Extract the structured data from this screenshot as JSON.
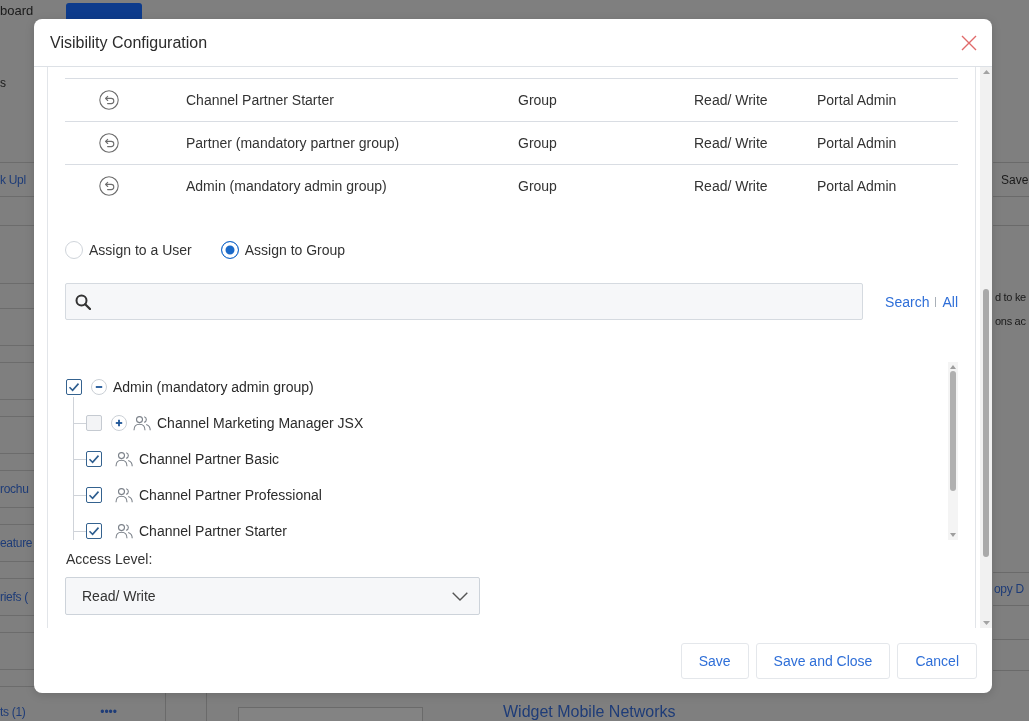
{
  "page_behind": {
    "nav_fragment": "board",
    "left_label": "s",
    "left_cards": [
      {
        "kind": "link",
        "text": "k Upl"
      },
      {
        "kind": "blank"
      },
      {
        "kind": "blank"
      },
      {
        "kind": "blank"
      },
      {
        "kind": "blank"
      },
      {
        "kind": "link",
        "text": "rochu"
      },
      {
        "kind": "link",
        "text": "eature"
      },
      {
        "kind": "link",
        "text": "riefs ("
      },
      {
        "kind": "blank"
      },
      {
        "kind": "link",
        "text": "ts (1)",
        "more": "••••"
      }
    ],
    "right_items": [
      {
        "kind": "button",
        "text": "Save"
      },
      {
        "kind": "text",
        "text": "d to ke"
      },
      {
        "kind": "text",
        "text": "ons ac"
      },
      {
        "kind": "link",
        "text": "opy D"
      }
    ],
    "bottom_link": "Widget Mobile Networks"
  },
  "dialog": {
    "title": "Visibility Configuration",
    "table": {
      "rows": [
        {
          "cells": [
            "Channel Partner Starter",
            "Group",
            "Read/ Write",
            "Portal Admin"
          ]
        },
        {
          "cells": [
            "Partner (mandatory partner group)",
            "Group",
            "Read/ Write",
            "Portal Admin"
          ]
        },
        {
          "cells": [
            "Admin (mandatory admin group)",
            "Group",
            "Read/ Write",
            "Portal Admin"
          ]
        }
      ]
    },
    "assign_options": [
      {
        "label": "Assign to a User",
        "selected": false
      },
      {
        "label": "Assign to Group",
        "selected": true
      }
    ],
    "search": {
      "links": [
        "Search",
        "All"
      ]
    },
    "tree": [
      {
        "label": "Admin (mandatory admin group)",
        "checked": true,
        "expanded": true,
        "children": [
          {
            "label": "Channel Marketing Manager JSX",
            "checked": false,
            "expanded": false
          },
          {
            "label": "Channel Partner Basic",
            "checked": true
          },
          {
            "label": "Channel Partner Professional",
            "checked": true
          },
          {
            "label": "Channel Partner Starter",
            "checked": true
          }
        ]
      }
    ],
    "access_level": {
      "label": "Access Level:",
      "value": "Read/ Write"
    },
    "buttons": [
      "Save",
      "Save and Close",
      "Cancel"
    ]
  }
}
